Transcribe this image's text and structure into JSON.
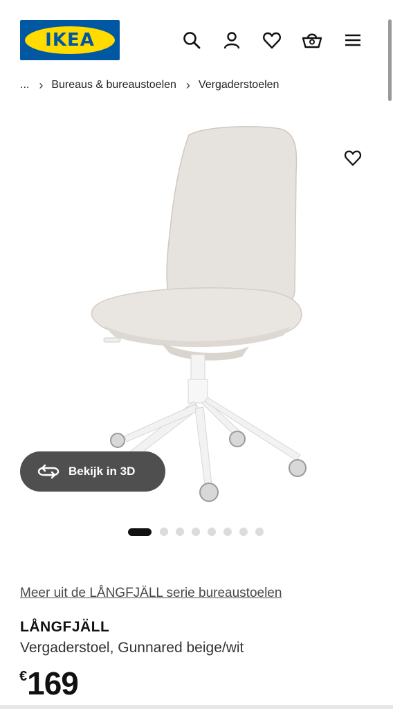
{
  "header": {
    "logo_text": "IKEA",
    "icons": [
      "search-icon",
      "user-icon",
      "heart-icon",
      "basket-icon",
      "menu-icon"
    ]
  },
  "breadcrumb": {
    "items": [
      "...",
      "Bureaus & bureaustoelen",
      "Vergaderstoelen"
    ]
  },
  "gallery": {
    "view_3d_label": "Bekijk in 3D",
    "dot_count": 8,
    "active_dot": 0
  },
  "product": {
    "series_link": "Meer uit de LÅNGFJÄLL serie bureaustoelen",
    "name": "LÅNGFJÄLL",
    "description": "Vergaderstoel, Gunnared beige/wit",
    "price_currency": "€",
    "price_value": "169"
  },
  "colors": {
    "brand_blue": "#0058a3",
    "brand_yellow": "#ffdb00",
    "button_dark": "#4f4f4f",
    "chair_fabric": "#e6e2dd"
  }
}
